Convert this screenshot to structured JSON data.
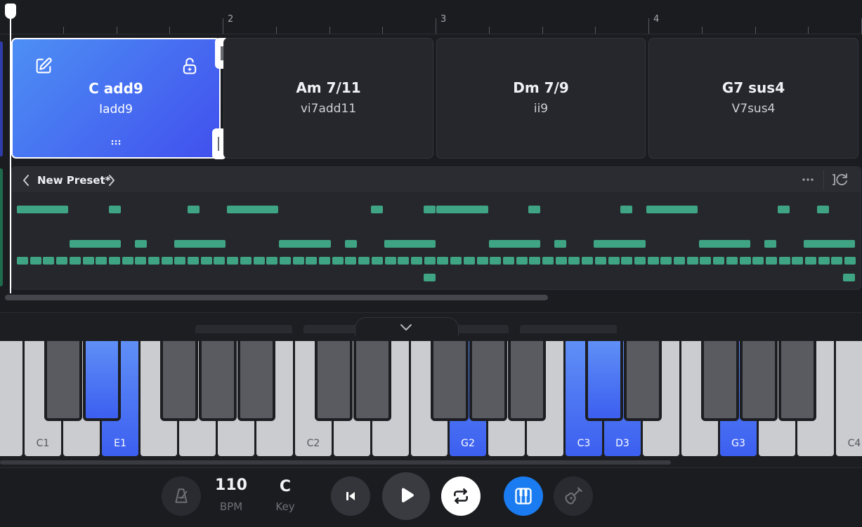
{
  "ruler": {
    "bars": [
      "2",
      "3",
      "4"
    ]
  },
  "chords": [
    {
      "name": "C add9",
      "roman": "Iadd9",
      "selected": true
    },
    {
      "name": "Am 7/11",
      "roman": "vi7add11",
      "selected": false
    },
    {
      "name": "Dm 7/9",
      "roman": "ii9",
      "selected": false
    },
    {
      "name": "G7 sus4",
      "roman": "V7sus4",
      "selected": false
    }
  ],
  "pattern": {
    "preset_name": "New Preset*"
  },
  "keyboard": {
    "octave_labels": [
      "C1",
      "C2",
      "C3",
      "C4"
    ],
    "highlighted_notes": [
      "E1",
      "G2",
      "C3",
      "D3",
      "G3"
    ]
  },
  "transport": {
    "bpm_value": "110",
    "bpm_label": "BPM",
    "key_value": "C",
    "key_label": "Key"
  },
  "colors": {
    "accent": "#4150ee",
    "note_green": "#3fa483",
    "play_blue": "#1a7cf0"
  }
}
